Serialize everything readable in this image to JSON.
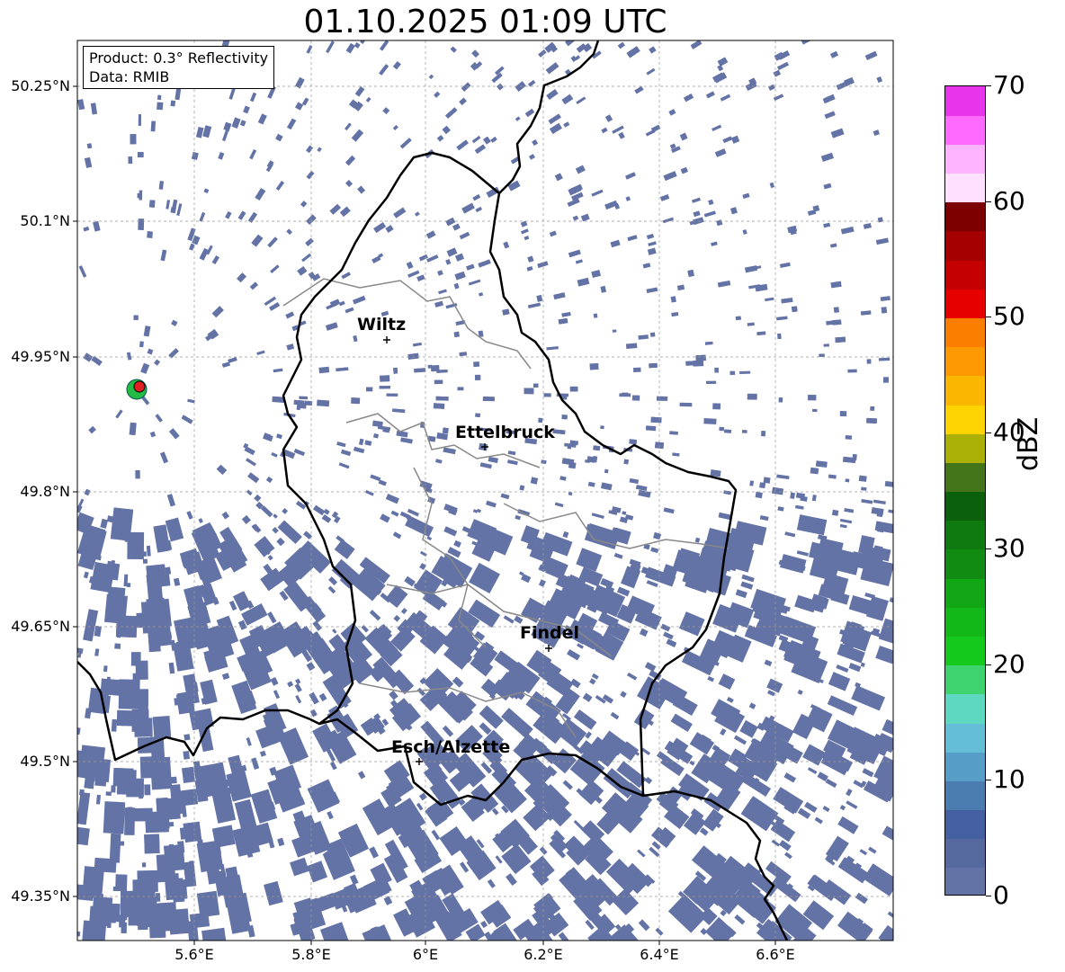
{
  "title": "01.10.2025 01:09 UTC",
  "info_box": {
    "product": "Product: 0.3° Reflectivity",
    "data": "Data: RMIB"
  },
  "latitude_labels": [
    "50.25°N",
    "50.1°N",
    "49.95°N",
    "49.8°N",
    "49.65°N",
    "49.5°N",
    "49.35°N"
  ],
  "longitude_labels": [
    "5.6°E",
    "5.8°E",
    "6°E",
    "6.2°E",
    "6.4°E",
    "6.6°E"
  ],
  "cities": [
    {
      "name": "Wiltz"
    },
    {
      "name": "Ettelbruck"
    },
    {
      "name": "Findel"
    },
    {
      "name": "Esch/Alzette"
    }
  ],
  "colorbar": {
    "label": "dBZ",
    "ticks": [
      "0",
      "10",
      "20",
      "30",
      "40",
      "50",
      "60",
      "70"
    ],
    "colors": [
      "#6473a6",
      "#56699f",
      "#4460a3",
      "#4b7cb0",
      "#569ec7",
      "#64bfd6",
      "#5fd8c1",
      "#3fd36f",
      "#14c81c",
      "#12b817",
      "#11a614",
      "#118b12",
      "#0e7a10",
      "#0a600b",
      "#44751b",
      "#aab006",
      "#fdd300",
      "#fbb600",
      "#fd9900",
      "#fb7e00",
      "#e60000",
      "#c40000",
      "#a40000",
      "#7c0000",
      "#ffe0ff",
      "#ffb4ff",
      "#ff6aff",
      "#e834ea"
    ]
  },
  "echo_color": "#6473a6"
}
